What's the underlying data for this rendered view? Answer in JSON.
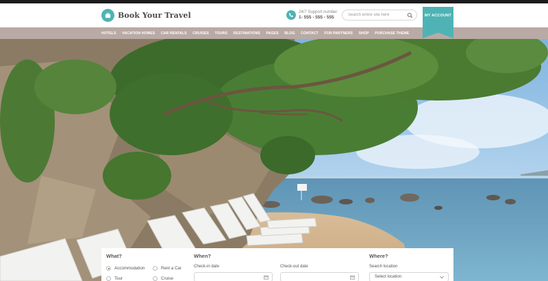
{
  "brand": {
    "name": "Book Your Travel",
    "logo_icon": "suitcase-icon",
    "accent": "#4fb3b5"
  },
  "support": {
    "label": "24/7 Support number",
    "number": "1- 555 - 555 - 555",
    "icon": "phone-icon"
  },
  "search": {
    "placeholder": "Search entire site here",
    "icon": "search-icon"
  },
  "account": {
    "label": "MY ACCOUNT"
  },
  "nav": {
    "items": [
      "HOTELS",
      "VACATION HOMES",
      "CAR RENTALS",
      "CRUISES",
      "TOURS",
      "DESTINATIONS",
      "PAGES",
      "BLOG",
      "CONTACT",
      "FOR PARTNERS",
      "SHOP",
      "PURCHASE THEME"
    ],
    "background": "#b9aaa5"
  },
  "search_panel": {
    "what": {
      "title": "What?",
      "options": [
        {
          "label": "Accommodation",
          "checked": true
        },
        {
          "label": "Rent a Car",
          "checked": false
        },
        {
          "label": "Tour",
          "checked": false
        },
        {
          "label": "Cruise",
          "checked": false
        }
      ]
    },
    "when": {
      "title": "When?",
      "checkin_label": "Check-in date",
      "checkout_label": "Check-out date"
    },
    "where": {
      "title": "Where?",
      "location_label": "Search location",
      "location_value": "Select location"
    }
  }
}
